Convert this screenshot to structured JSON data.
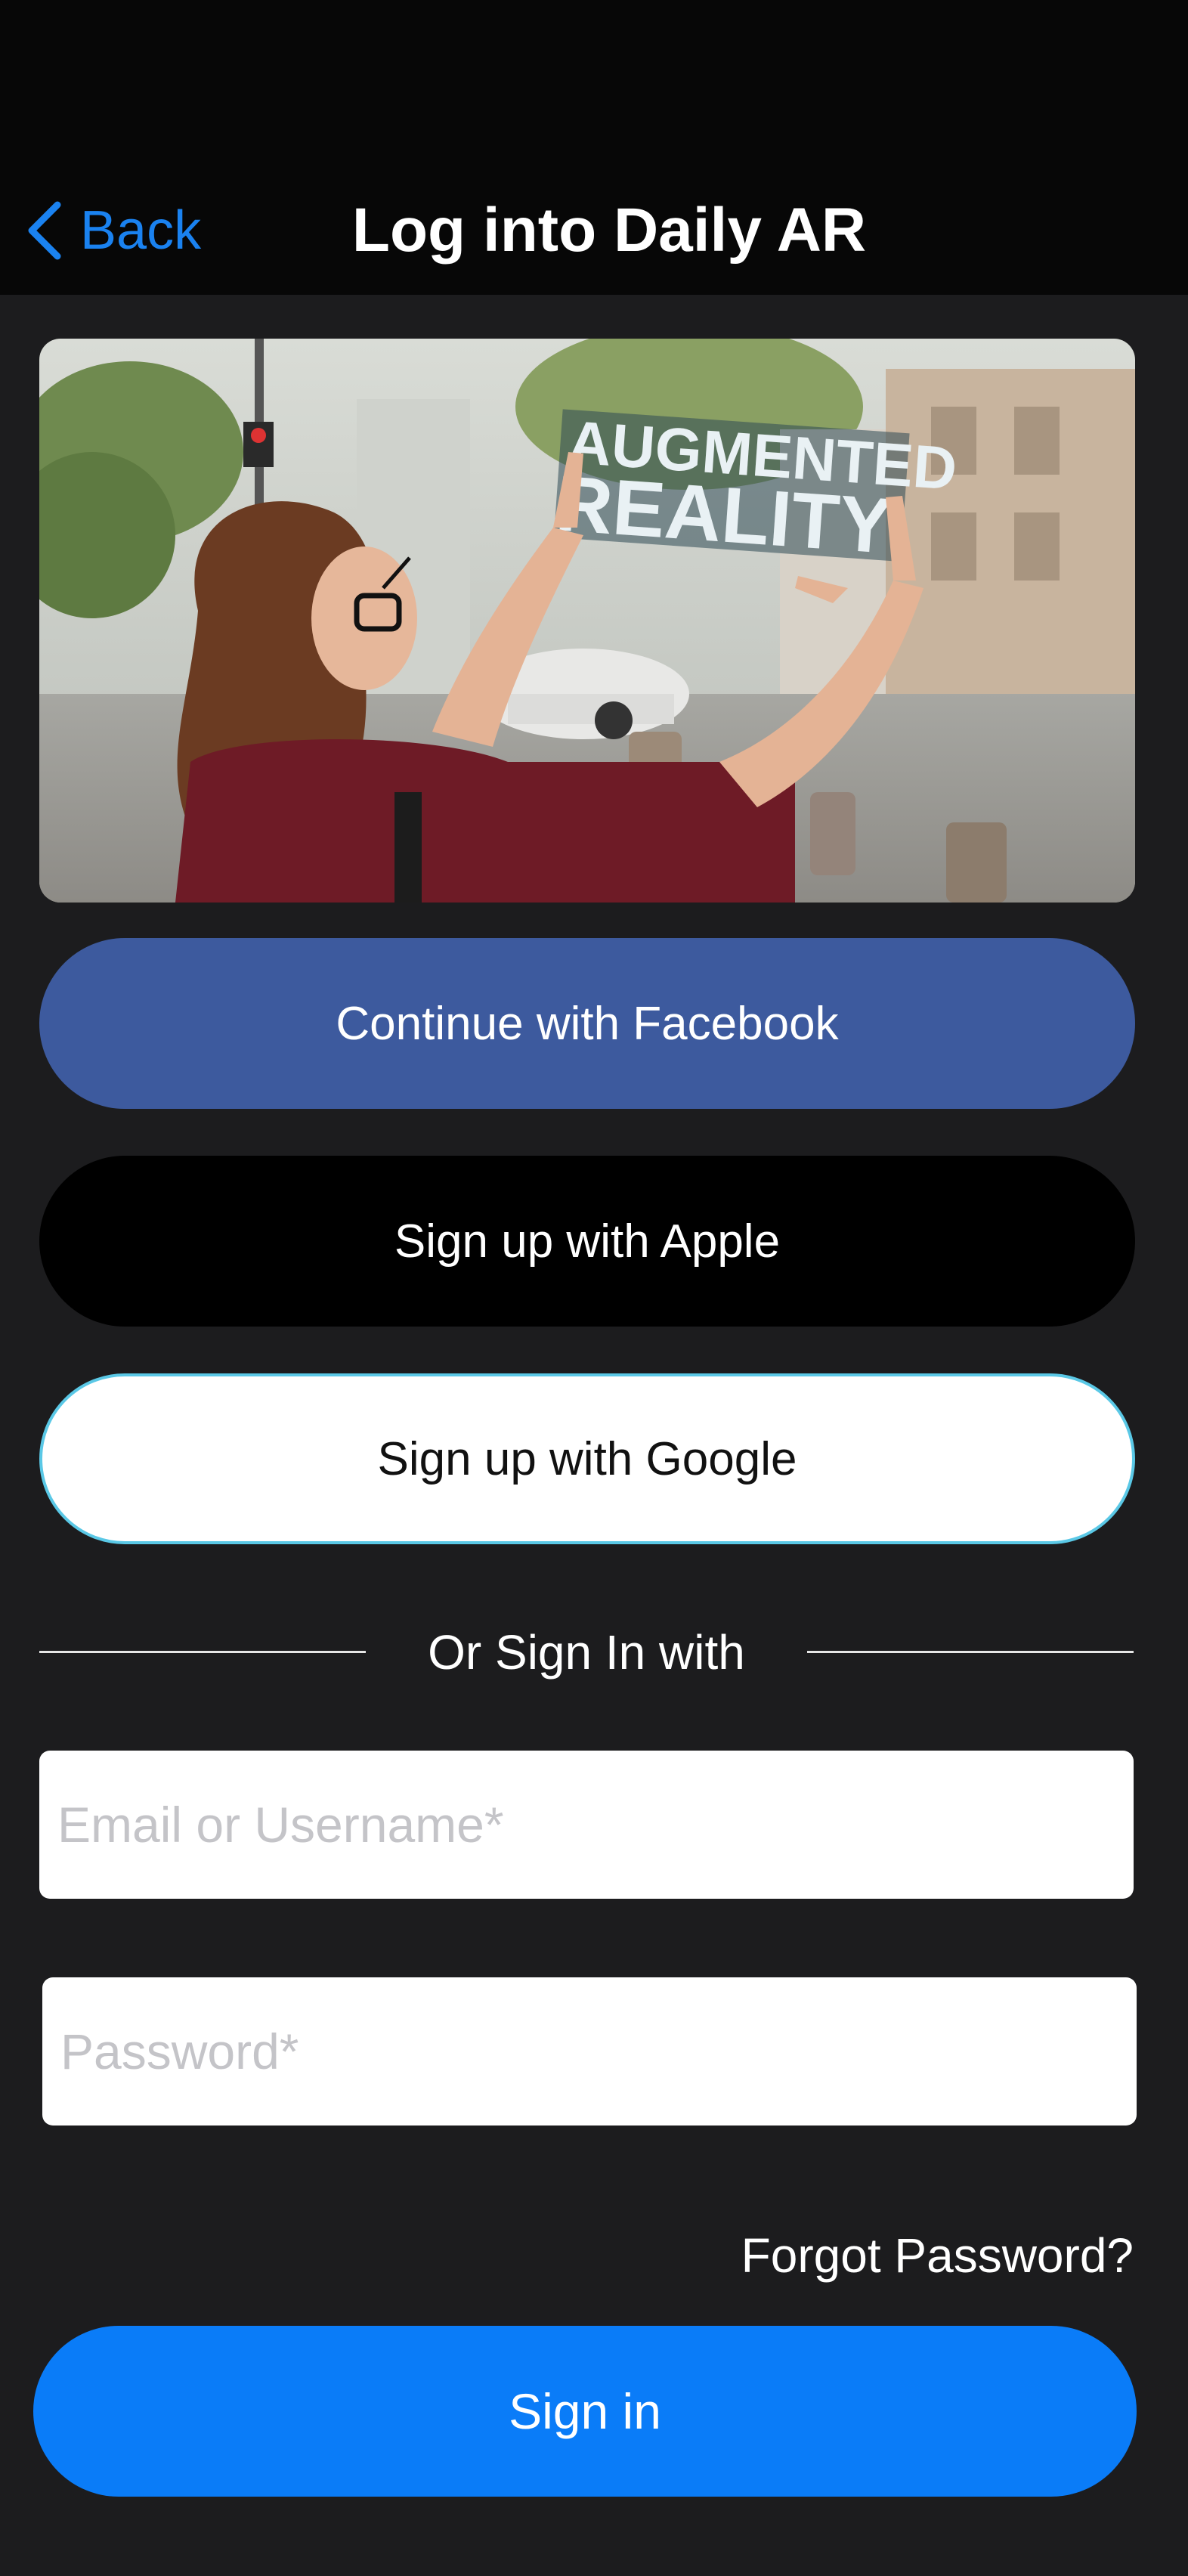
{
  "header": {
    "back_label": "Back",
    "title": "Log into Daily AR",
    "back_icon": "chevron-left-icon",
    "accent_color": "#1a82f0"
  },
  "hero": {
    "overlay_text_line1": "AUGMENTED",
    "overlay_text_line2": "REALITY"
  },
  "social": {
    "facebook_label": "Continue with Facebook",
    "apple_label": "Sign up with Apple",
    "google_label": "Sign up with Google",
    "facebook_color": "#3d5a9e",
    "apple_color": "#000000",
    "google_color": "#ffffff"
  },
  "divider": {
    "text": "Or Sign In with"
  },
  "form": {
    "email_placeholder": "Email or Username*",
    "email_value": "",
    "password_placeholder": "Password*",
    "password_value": "",
    "forgot_label": "Forgot Password?",
    "signin_label": "Sign in",
    "signin_color": "#0a7cf8"
  }
}
